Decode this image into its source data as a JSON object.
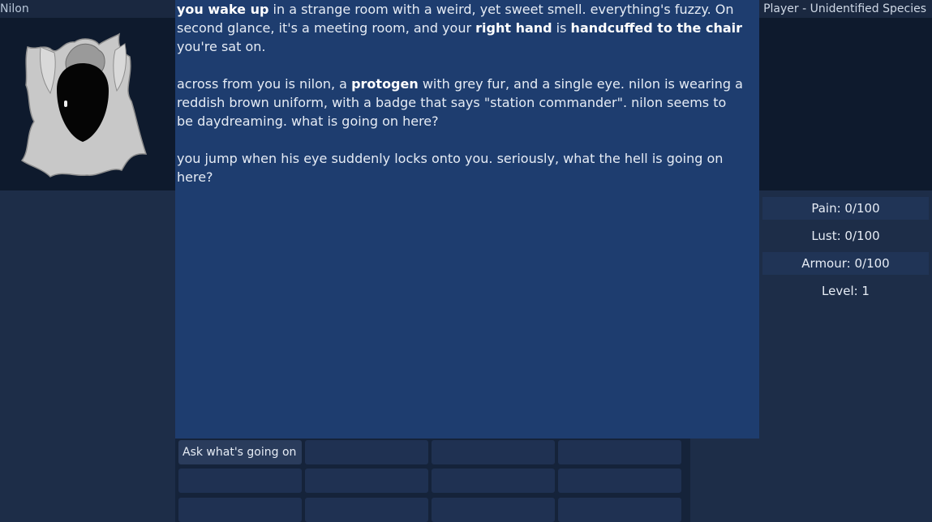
{
  "npc": {
    "name": "Nilon"
  },
  "player": {
    "title": "Player - Unidentified Species"
  },
  "story": {
    "p1": [
      {
        "text": "you wake up",
        "bold": true
      },
      {
        "text": " in a strange room with a weird, yet sweet smell. everything's fuzzy. On second glance, it's a meeting room, and your ",
        "bold": false
      },
      {
        "text": "right hand",
        "bold": true
      },
      {
        "text": " is ",
        "bold": false
      },
      {
        "text": "handcuffed to the chair",
        "bold": true
      },
      {
        "text": " you're sat on.",
        "bold": false
      }
    ],
    "p2": [
      {
        "text": "across from you is nilon, a ",
        "bold": false
      },
      {
        "text": "protogen",
        "bold": true
      },
      {
        "text": " with grey fur, and a single eye. nilon is wearing a reddish brown uniform, with a badge that says \"station commander\". nilon seems to be daydreaming. what is going on here?",
        "bold": false
      }
    ],
    "p3": [
      {
        "text": "you jump when his eye suddenly locks onto you. seriously, what the hell is going on here?",
        "bold": false
      }
    ]
  },
  "stats": {
    "pain": "Pain: 0/100",
    "lust": "Lust: 0/100",
    "armour": "Armour: 0/100",
    "level": "Level: 1"
  },
  "actions": {
    "ask": "Ask what's going on"
  }
}
